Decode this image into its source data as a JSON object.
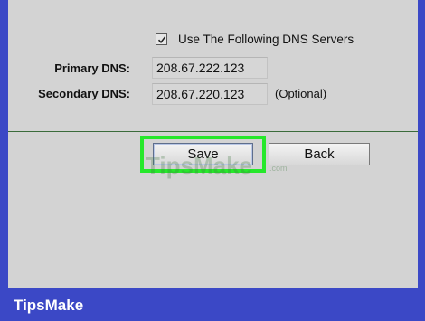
{
  "dns_option": {
    "checked": true,
    "label": "Use The Following DNS Servers"
  },
  "primary_dns": {
    "label": "Primary DNS:",
    "value": "208.67.222.123"
  },
  "secondary_dns": {
    "label": "Secondary DNS:",
    "value": "208.67.220.123",
    "note": "(Optional)"
  },
  "buttons": {
    "save_label": "Save",
    "back_label": "Back"
  },
  "watermark": {
    "text": "TipsMake",
    "suffix": ".com"
  },
  "brand": "TipsMake",
  "colors": {
    "page_background": "#3b48c6",
    "panel": "#d3d3d3",
    "highlight": "#26e82b",
    "divider": "#3a6b3a"
  }
}
